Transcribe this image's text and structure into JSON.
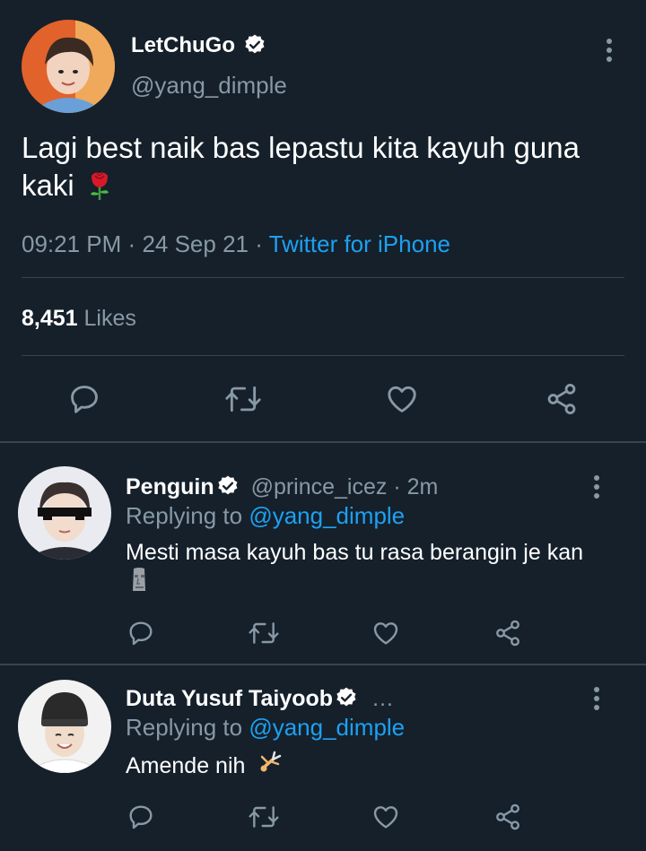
{
  "main_tweet": {
    "display_name": "LetChuGo",
    "handle": "@yang_dimple",
    "text": "Lagi best naik bas lepastu kita kayuh guna kaki",
    "time": "09:21 PM",
    "separator": "·",
    "date": "24 Sep 21",
    "source": "Twitter for iPhone",
    "likes_count": "8,451",
    "likes_label": "Likes",
    "emoji": "rose"
  },
  "replies": [
    {
      "display_name": "Penguin",
      "handle": "@prince_icez",
      "separator": "·",
      "time": "2m",
      "replying_prefix": "Replying to",
      "replying_to": "@yang_dimple",
      "text": "Mesti masa kayuh bas tu rasa berangin je kan",
      "emoji": "moai"
    },
    {
      "display_name": "Duta Yusuf Taiyoob",
      "ellipsis": "…",
      "replying_prefix": "Replying to",
      "replying_to": "@yang_dimple",
      "text": "Amende nih",
      "emoji": "person-cartwheeling"
    }
  ],
  "colors": {
    "background": "#15202b",
    "text": "#ffffff",
    "secondary": "#8899a6",
    "link": "#1da1f2",
    "divider": "#38444d"
  }
}
